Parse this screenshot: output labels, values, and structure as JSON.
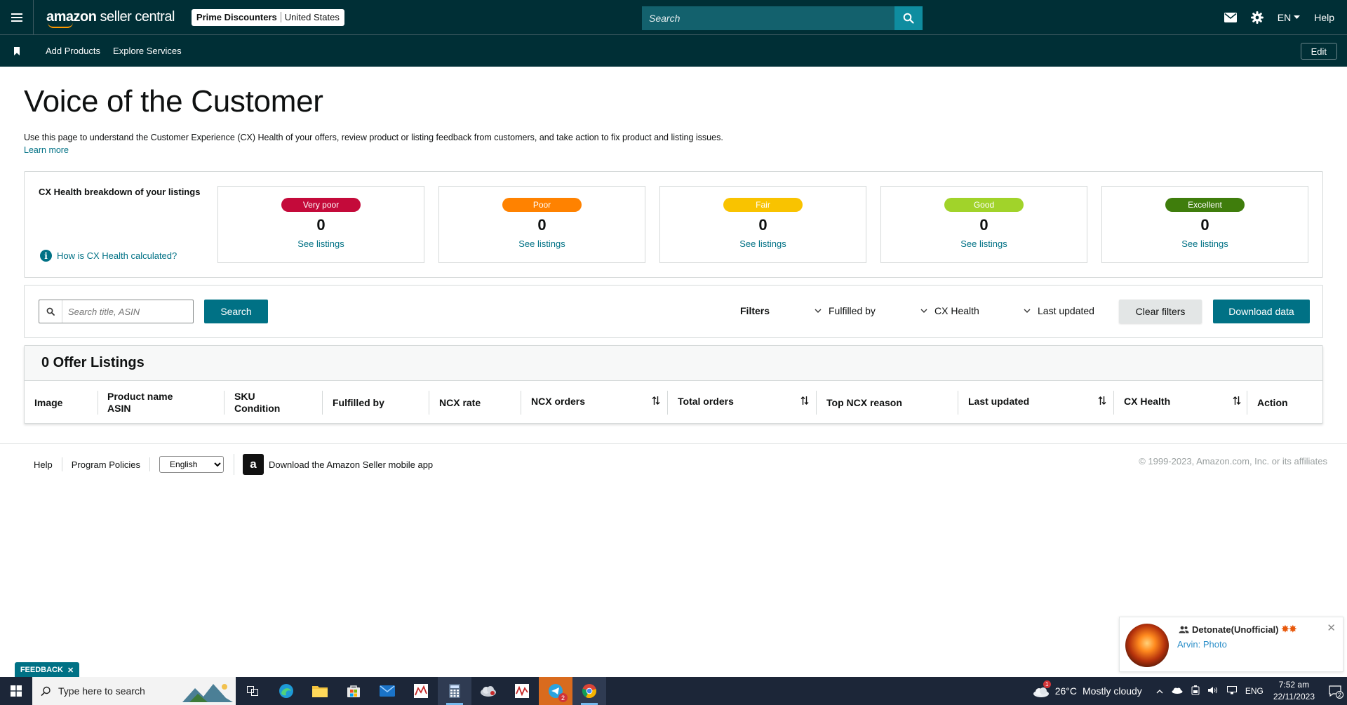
{
  "topbar": {
    "logo_bold": "amazon",
    "logo_rest": " seller central",
    "store_name": "Prime Discounters",
    "store_region": "United States",
    "search_placeholder": "Search",
    "language": "EN",
    "help": "Help"
  },
  "navbar": {
    "links": [
      "Add Products",
      "Explore Services"
    ],
    "edit": "Edit"
  },
  "page": {
    "title": "Voice of the Customer",
    "description": "Use this page to understand the Customer Experience (CX) Health of your offers, review product or listing feedback from customers, and take action to fix product and listing issues.",
    "learn_more": "Learn more"
  },
  "health": {
    "title": "CX Health breakdown of your listings",
    "help_link": "How is CX Health calculated?",
    "cards": [
      {
        "label": "Very poor",
        "count": "0",
        "link": "See listings",
        "color": "#c40a3a"
      },
      {
        "label": "Poor",
        "count": "0",
        "link": "See listings",
        "color": "#ff8200"
      },
      {
        "label": "Fair",
        "count": "0",
        "link": "See listings",
        "color": "#f9c300"
      },
      {
        "label": "Good",
        "count": "0",
        "link": "See listings",
        "color": "#a1d32a"
      },
      {
        "label": "Excellent",
        "count": "0",
        "link": "See listings",
        "color": "#3f7d0c"
      }
    ]
  },
  "filters": {
    "search_placeholder": "Search title, ASIN",
    "search_button": "Search",
    "label": "Filters",
    "dropdowns": [
      "Fulfilled by",
      "CX Health",
      "Last updated"
    ],
    "clear": "Clear filters",
    "download": "Download data"
  },
  "listings": {
    "heading": "0 Offer Listings",
    "columns": [
      {
        "line1": "Image",
        "line2": ""
      },
      {
        "line1": "Product name",
        "line2": "ASIN"
      },
      {
        "line1": "SKU",
        "line2": "Condition"
      },
      {
        "line1": "Fulfilled by",
        "line2": ""
      },
      {
        "line1": "NCX rate",
        "line2": ""
      },
      {
        "line1": "NCX orders",
        "line2": ""
      },
      {
        "line1": "Total orders",
        "line2": ""
      },
      {
        "line1": "Top NCX reason",
        "line2": ""
      },
      {
        "line1": "Last updated",
        "line2": ""
      },
      {
        "line1": "CX Health",
        "line2": ""
      },
      {
        "line1": "Action",
        "line2": ""
      }
    ]
  },
  "footer": {
    "help": "Help",
    "policies": "Program Policies",
    "language": "English",
    "app_download": "Download the Amazon Seller mobile app",
    "copyright": "© 1999-2023, Amazon.com, Inc. or its affiliates"
  },
  "feedback_tab": "FEEDBACK",
  "toast": {
    "title": "Detonate(Unofficial)",
    "subtitle": "Arvin: Photo"
  },
  "taskbar": {
    "search_text": "Type here to search",
    "temperature": "26°C",
    "weather": "Mostly cloudy",
    "weather_badge": "1",
    "language": "ENG",
    "time": "7:52 am",
    "date": "22/11/2023",
    "notifications": "2",
    "app_badge": "2"
  }
}
